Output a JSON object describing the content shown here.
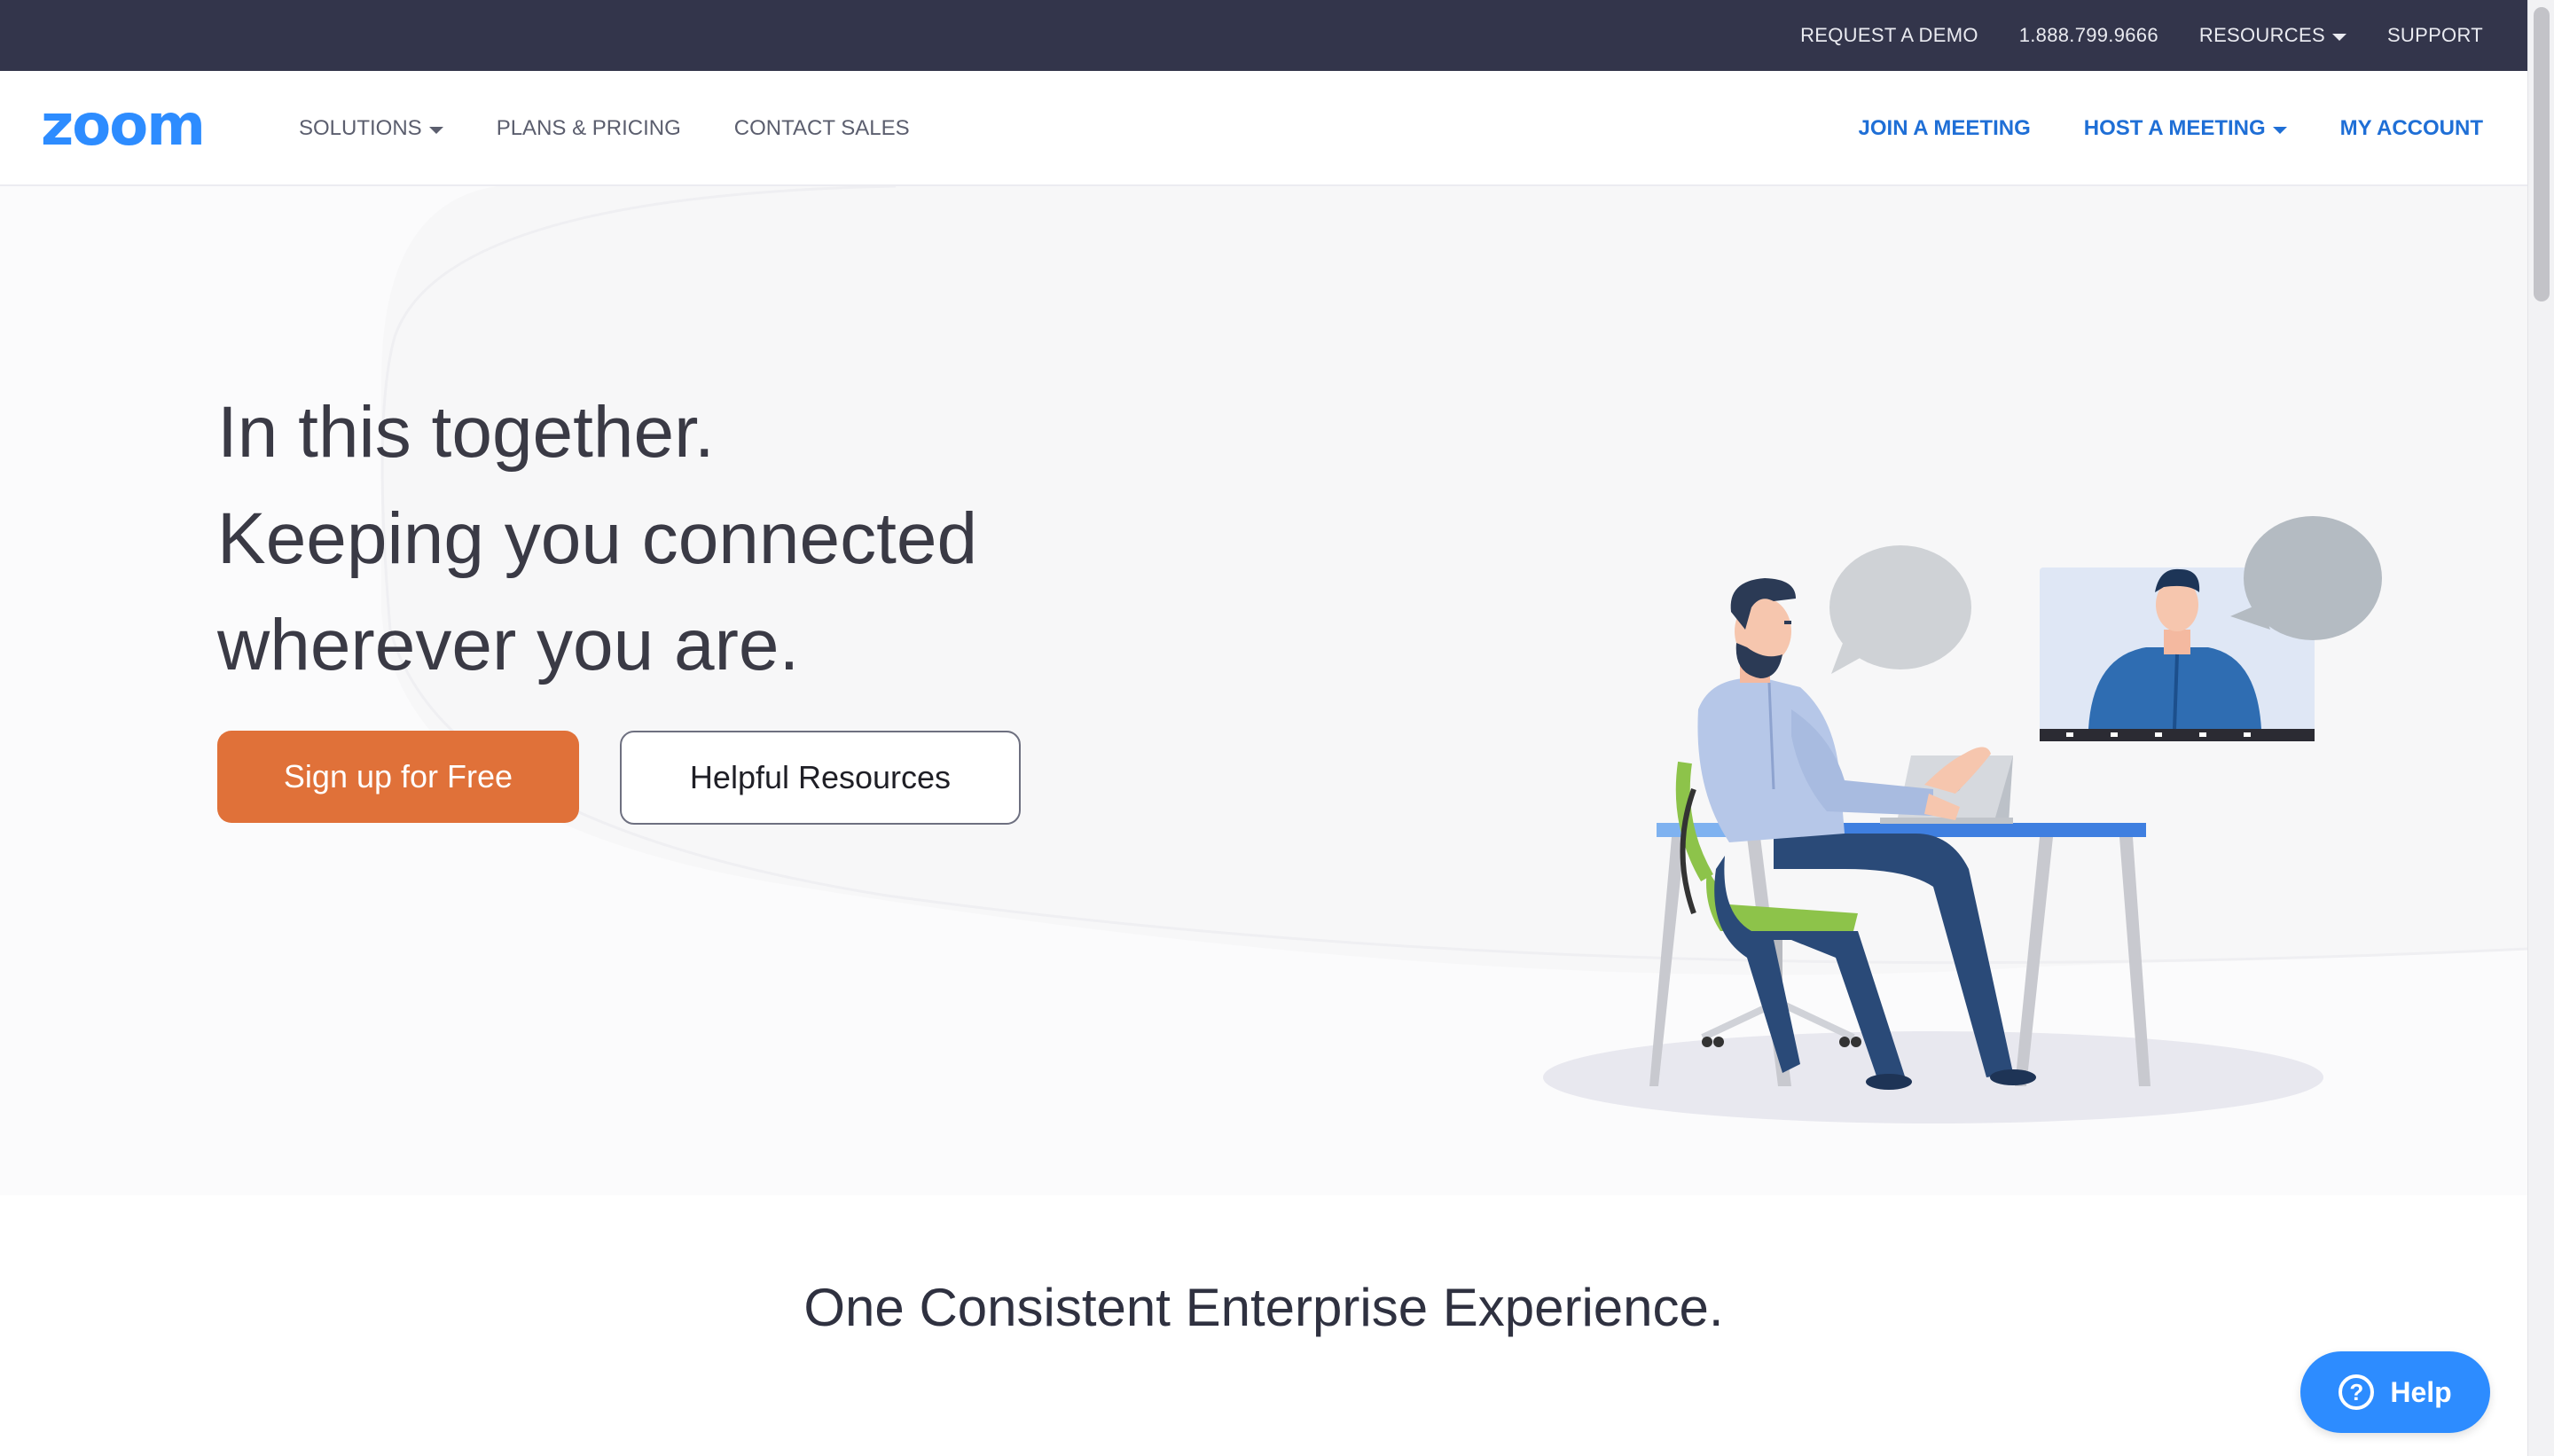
{
  "utility_bar": {
    "request_demo": "REQUEST A DEMO",
    "phone": "1.888.799.9666",
    "resources": "RESOURCES",
    "support": "SUPPORT"
  },
  "nav": {
    "logo": "zoom",
    "solutions": "SOLUTIONS",
    "plans_pricing": "PLANS & PRICING",
    "contact_sales": "CONTACT SALES",
    "join_meeting": "JOIN A MEETING",
    "host_meeting": "HOST A MEETING",
    "my_account": "MY ACCOUNT"
  },
  "hero": {
    "lines": [
      "In this together.",
      "Keeping you connected",
      "wherever you are."
    ],
    "primary_button": "Sign up for Free",
    "secondary_button": "Helpful Resources"
  },
  "section": {
    "heading": "One Consistent Enterprise Experience."
  },
  "help": {
    "icon": "?",
    "label": "Help"
  },
  "colors": {
    "utility_bar_bg": "#33354b",
    "brand_blue": "#2d8cff",
    "nav_link_blue": "#1f6fd6",
    "primary_button": "#e07139",
    "hero_bg": "#f7f7f8"
  },
  "icons": {
    "dropdown": "caret-down-icon",
    "help": "question-circle-icon"
  }
}
